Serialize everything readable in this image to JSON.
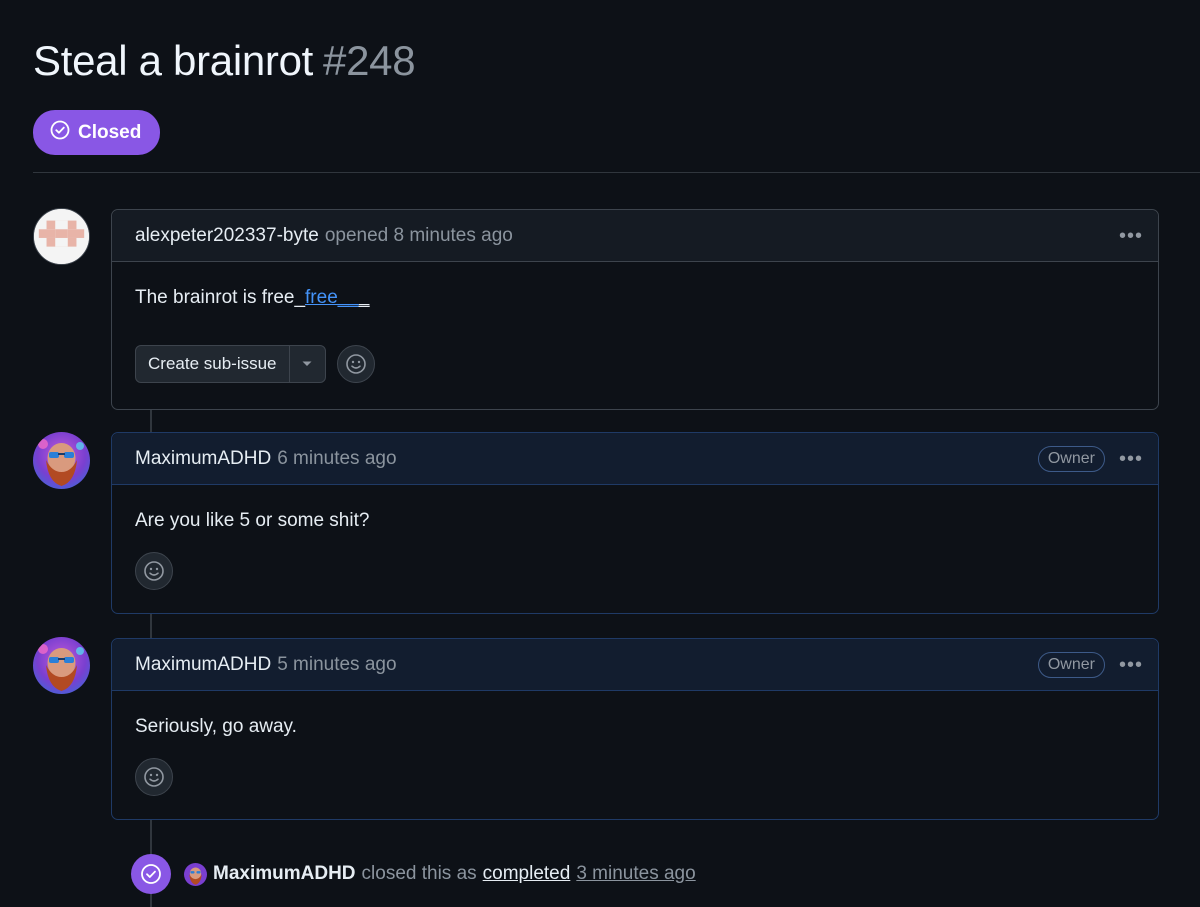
{
  "issue": {
    "title": "Steal a brainrot",
    "number": "#248",
    "state": "Closed",
    "state_color": "#8957e5"
  },
  "comments": [
    {
      "author": "alexpeter202337-byte",
      "meta": "opened 8 minutes ago",
      "body_prefix": "The brainrot is free_",
      "body_link": "free__",
      "body_suffix": "_",
      "sub_issue_label": "Create sub-issue",
      "more_icon": "kebab-horizontal-icon"
    },
    {
      "author": "MaximumADHD",
      "meta": "6 minutes ago",
      "badge": "Owner",
      "body": "Are you like 5 or some shit?",
      "more_icon": "kebab-horizontal-icon"
    },
    {
      "author": "MaximumADHD",
      "meta": "5 minutes ago",
      "badge": "Owner",
      "body": "Seriously, go away.",
      "more_icon": "kebab-horizontal-icon"
    }
  ],
  "event": {
    "author": "MaximumADHD",
    "text": "closed this as",
    "reason": "completed",
    "time": "3 minutes ago",
    "icon": "check-circle-icon"
  },
  "colors": {
    "background": "#0d1117",
    "accent_purple": "#8957e5",
    "link_blue": "#4493f8",
    "owner_border": "#1f3a66"
  }
}
